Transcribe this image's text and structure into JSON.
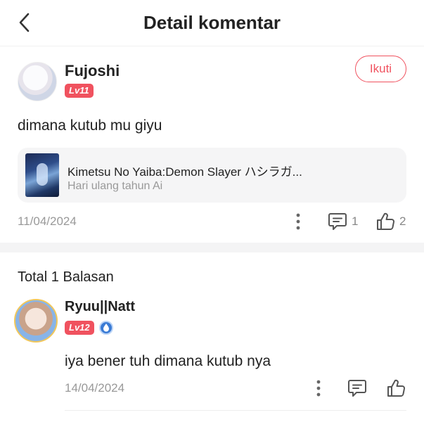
{
  "header": {
    "title": "Detail komentar"
  },
  "comment": {
    "username": "Fujoshi",
    "level": "Lv11",
    "follow_label": "Ikuti",
    "text": "dimana kutub mu giyu",
    "book": {
      "title": "Kimetsu No Yaiba:Demon Slayer ハシラガ...",
      "subtitle": "Hari ulang tahun Ai"
    },
    "date": "11/04/2024",
    "reply_count": "1",
    "like_count": "2"
  },
  "replies": {
    "total_label": "Total 1 Balasan",
    "items": [
      {
        "username": "Ryuu||Natt",
        "level": "Lv12",
        "text": "iya bener tuh dimana kutub nya",
        "date": "14/04/2024"
      }
    ]
  },
  "colors": {
    "accent": "#f0525f",
    "muted": "#999999",
    "divider": "#f4f4f5"
  }
}
